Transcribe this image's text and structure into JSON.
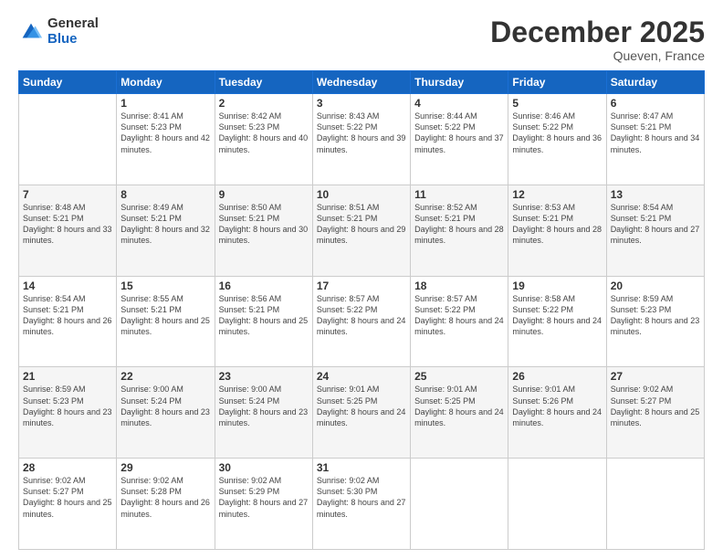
{
  "header": {
    "logo_general": "General",
    "logo_blue": "Blue",
    "title": "December 2025",
    "subtitle": "Queven, France"
  },
  "calendar": {
    "days_of_week": [
      "Sunday",
      "Monday",
      "Tuesday",
      "Wednesday",
      "Thursday",
      "Friday",
      "Saturday"
    ],
    "weeks": [
      [
        {
          "day": "",
          "sunrise": "",
          "sunset": "",
          "daylight": ""
        },
        {
          "day": "1",
          "sunrise": "Sunrise: 8:41 AM",
          "sunset": "Sunset: 5:23 PM",
          "daylight": "Daylight: 8 hours and 42 minutes."
        },
        {
          "day": "2",
          "sunrise": "Sunrise: 8:42 AM",
          "sunset": "Sunset: 5:23 PM",
          "daylight": "Daylight: 8 hours and 40 minutes."
        },
        {
          "day": "3",
          "sunrise": "Sunrise: 8:43 AM",
          "sunset": "Sunset: 5:22 PM",
          "daylight": "Daylight: 8 hours and 39 minutes."
        },
        {
          "day": "4",
          "sunrise": "Sunrise: 8:44 AM",
          "sunset": "Sunset: 5:22 PM",
          "daylight": "Daylight: 8 hours and 37 minutes."
        },
        {
          "day": "5",
          "sunrise": "Sunrise: 8:46 AM",
          "sunset": "Sunset: 5:22 PM",
          "daylight": "Daylight: 8 hours and 36 minutes."
        },
        {
          "day": "6",
          "sunrise": "Sunrise: 8:47 AM",
          "sunset": "Sunset: 5:21 PM",
          "daylight": "Daylight: 8 hours and 34 minutes."
        }
      ],
      [
        {
          "day": "7",
          "sunrise": "Sunrise: 8:48 AM",
          "sunset": "Sunset: 5:21 PM",
          "daylight": "Daylight: 8 hours and 33 minutes."
        },
        {
          "day": "8",
          "sunrise": "Sunrise: 8:49 AM",
          "sunset": "Sunset: 5:21 PM",
          "daylight": "Daylight: 8 hours and 32 minutes."
        },
        {
          "day": "9",
          "sunrise": "Sunrise: 8:50 AM",
          "sunset": "Sunset: 5:21 PM",
          "daylight": "Daylight: 8 hours and 30 minutes."
        },
        {
          "day": "10",
          "sunrise": "Sunrise: 8:51 AM",
          "sunset": "Sunset: 5:21 PM",
          "daylight": "Daylight: 8 hours and 29 minutes."
        },
        {
          "day": "11",
          "sunrise": "Sunrise: 8:52 AM",
          "sunset": "Sunset: 5:21 PM",
          "daylight": "Daylight: 8 hours and 28 minutes."
        },
        {
          "day": "12",
          "sunrise": "Sunrise: 8:53 AM",
          "sunset": "Sunset: 5:21 PM",
          "daylight": "Daylight: 8 hours and 28 minutes."
        },
        {
          "day": "13",
          "sunrise": "Sunrise: 8:54 AM",
          "sunset": "Sunset: 5:21 PM",
          "daylight": "Daylight: 8 hours and 27 minutes."
        }
      ],
      [
        {
          "day": "14",
          "sunrise": "Sunrise: 8:54 AM",
          "sunset": "Sunset: 5:21 PM",
          "daylight": "Daylight: 8 hours and 26 minutes."
        },
        {
          "day": "15",
          "sunrise": "Sunrise: 8:55 AM",
          "sunset": "Sunset: 5:21 PM",
          "daylight": "Daylight: 8 hours and 25 minutes."
        },
        {
          "day": "16",
          "sunrise": "Sunrise: 8:56 AM",
          "sunset": "Sunset: 5:21 PM",
          "daylight": "Daylight: 8 hours and 25 minutes."
        },
        {
          "day": "17",
          "sunrise": "Sunrise: 8:57 AM",
          "sunset": "Sunset: 5:22 PM",
          "daylight": "Daylight: 8 hours and 24 minutes."
        },
        {
          "day": "18",
          "sunrise": "Sunrise: 8:57 AM",
          "sunset": "Sunset: 5:22 PM",
          "daylight": "Daylight: 8 hours and 24 minutes."
        },
        {
          "day": "19",
          "sunrise": "Sunrise: 8:58 AM",
          "sunset": "Sunset: 5:22 PM",
          "daylight": "Daylight: 8 hours and 24 minutes."
        },
        {
          "day": "20",
          "sunrise": "Sunrise: 8:59 AM",
          "sunset": "Sunset: 5:23 PM",
          "daylight": "Daylight: 8 hours and 23 minutes."
        }
      ],
      [
        {
          "day": "21",
          "sunrise": "Sunrise: 8:59 AM",
          "sunset": "Sunset: 5:23 PM",
          "daylight": "Daylight: 8 hours and 23 minutes."
        },
        {
          "day": "22",
          "sunrise": "Sunrise: 9:00 AM",
          "sunset": "Sunset: 5:24 PM",
          "daylight": "Daylight: 8 hours and 23 minutes."
        },
        {
          "day": "23",
          "sunrise": "Sunrise: 9:00 AM",
          "sunset": "Sunset: 5:24 PM",
          "daylight": "Daylight: 8 hours and 23 minutes."
        },
        {
          "day": "24",
          "sunrise": "Sunrise: 9:01 AM",
          "sunset": "Sunset: 5:25 PM",
          "daylight": "Daylight: 8 hours and 24 minutes."
        },
        {
          "day": "25",
          "sunrise": "Sunrise: 9:01 AM",
          "sunset": "Sunset: 5:25 PM",
          "daylight": "Daylight: 8 hours and 24 minutes."
        },
        {
          "day": "26",
          "sunrise": "Sunrise: 9:01 AM",
          "sunset": "Sunset: 5:26 PM",
          "daylight": "Daylight: 8 hours and 24 minutes."
        },
        {
          "day": "27",
          "sunrise": "Sunrise: 9:02 AM",
          "sunset": "Sunset: 5:27 PM",
          "daylight": "Daylight: 8 hours and 25 minutes."
        }
      ],
      [
        {
          "day": "28",
          "sunrise": "Sunrise: 9:02 AM",
          "sunset": "Sunset: 5:27 PM",
          "daylight": "Daylight: 8 hours and 25 minutes."
        },
        {
          "day": "29",
          "sunrise": "Sunrise: 9:02 AM",
          "sunset": "Sunset: 5:28 PM",
          "daylight": "Daylight: 8 hours and 26 minutes."
        },
        {
          "day": "30",
          "sunrise": "Sunrise: 9:02 AM",
          "sunset": "Sunset: 5:29 PM",
          "daylight": "Daylight: 8 hours and 27 minutes."
        },
        {
          "day": "31",
          "sunrise": "Sunrise: 9:02 AM",
          "sunset": "Sunset: 5:30 PM",
          "daylight": "Daylight: 8 hours and 27 minutes."
        },
        {
          "day": "",
          "sunrise": "",
          "sunset": "",
          "daylight": ""
        },
        {
          "day": "",
          "sunrise": "",
          "sunset": "",
          "daylight": ""
        },
        {
          "day": "",
          "sunrise": "",
          "sunset": "",
          "daylight": ""
        }
      ]
    ]
  }
}
